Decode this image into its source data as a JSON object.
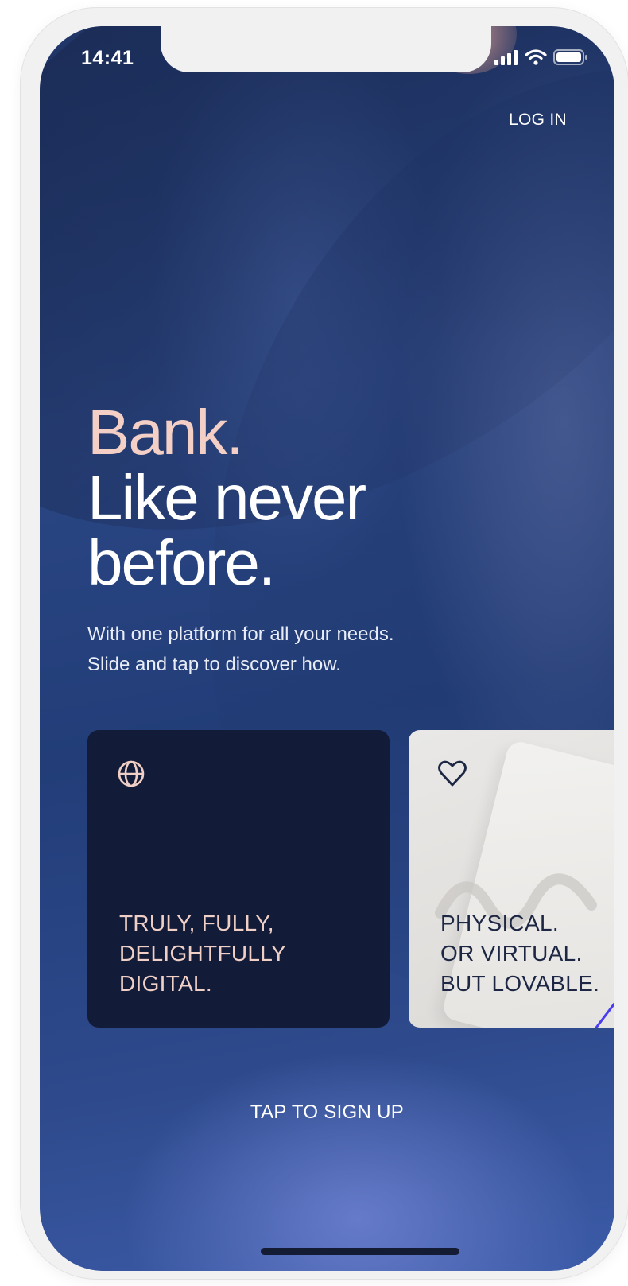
{
  "status_bar": {
    "time": "14:41",
    "icons": [
      "signal-icon",
      "wifi-icon",
      "battery-icon"
    ]
  },
  "header": {
    "login_label": "LOG IN"
  },
  "hero": {
    "headline_line1": "Bank.",
    "headline_line2": "Like never",
    "headline_line3": "before.",
    "subtext_line1": "With one platform for all your needs.",
    "subtext_line2": "Slide and tap to discover how."
  },
  "cards": [
    {
      "icon": "globe-icon",
      "lines": [
        "TRULY, FULLY,",
        "DELIGHTFULLY",
        "DIGITAL."
      ]
    },
    {
      "icon": "heart-icon",
      "lines": [
        "PHYSICAL.",
        "OR VIRTUAL.",
        "BUT LOVABLE."
      ]
    }
  ],
  "footer": {
    "signup_label": "TAP TO SIGN UP"
  },
  "colors": {
    "accent_pink": "#f3cfc6",
    "card_dark": "#121b38",
    "card_light": "#e9e8e6",
    "background_blue": "#2b4784"
  }
}
